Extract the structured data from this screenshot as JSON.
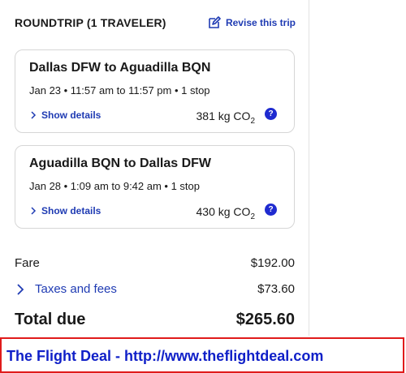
{
  "header": {
    "title": "ROUNDTRIP (1 TRAVELER)",
    "revise_label": "Revise this trip"
  },
  "flights": [
    {
      "route": "Dallas DFW to Aguadilla BQN",
      "info": "Jan 23 • 11:57 am to 11:57 pm • 1 stop",
      "details_label": "Show details",
      "co2_value": "381 kg CO",
      "co2_sub": "2",
      "help": "?"
    },
    {
      "route": "Aguadilla BQN to Dallas DFW",
      "info": "Jan 28 • 1:09 am to 9:42 am • 1 stop",
      "details_label": "Show details",
      "co2_value": "430 kg CO",
      "co2_sub": "2",
      "help": "?"
    }
  ],
  "summary": {
    "fare_label": "Fare",
    "fare_value": "$192.00",
    "taxes_label": "Taxes and fees",
    "taxes_value": "$73.60",
    "total_label": "Total due",
    "total_value": "$265.60"
  },
  "banner": {
    "text": "The Flight Deal - http://www.theflightdeal.com"
  },
  "colors": {
    "link": "#1f3bb3",
    "help_badge": "#1f2bd0",
    "banner_border": "#e01b1b",
    "banner_text": "#1020c8"
  },
  "icons": {
    "revise": "edit-icon",
    "details": "chevron-right-icon",
    "help": "question-icon"
  }
}
